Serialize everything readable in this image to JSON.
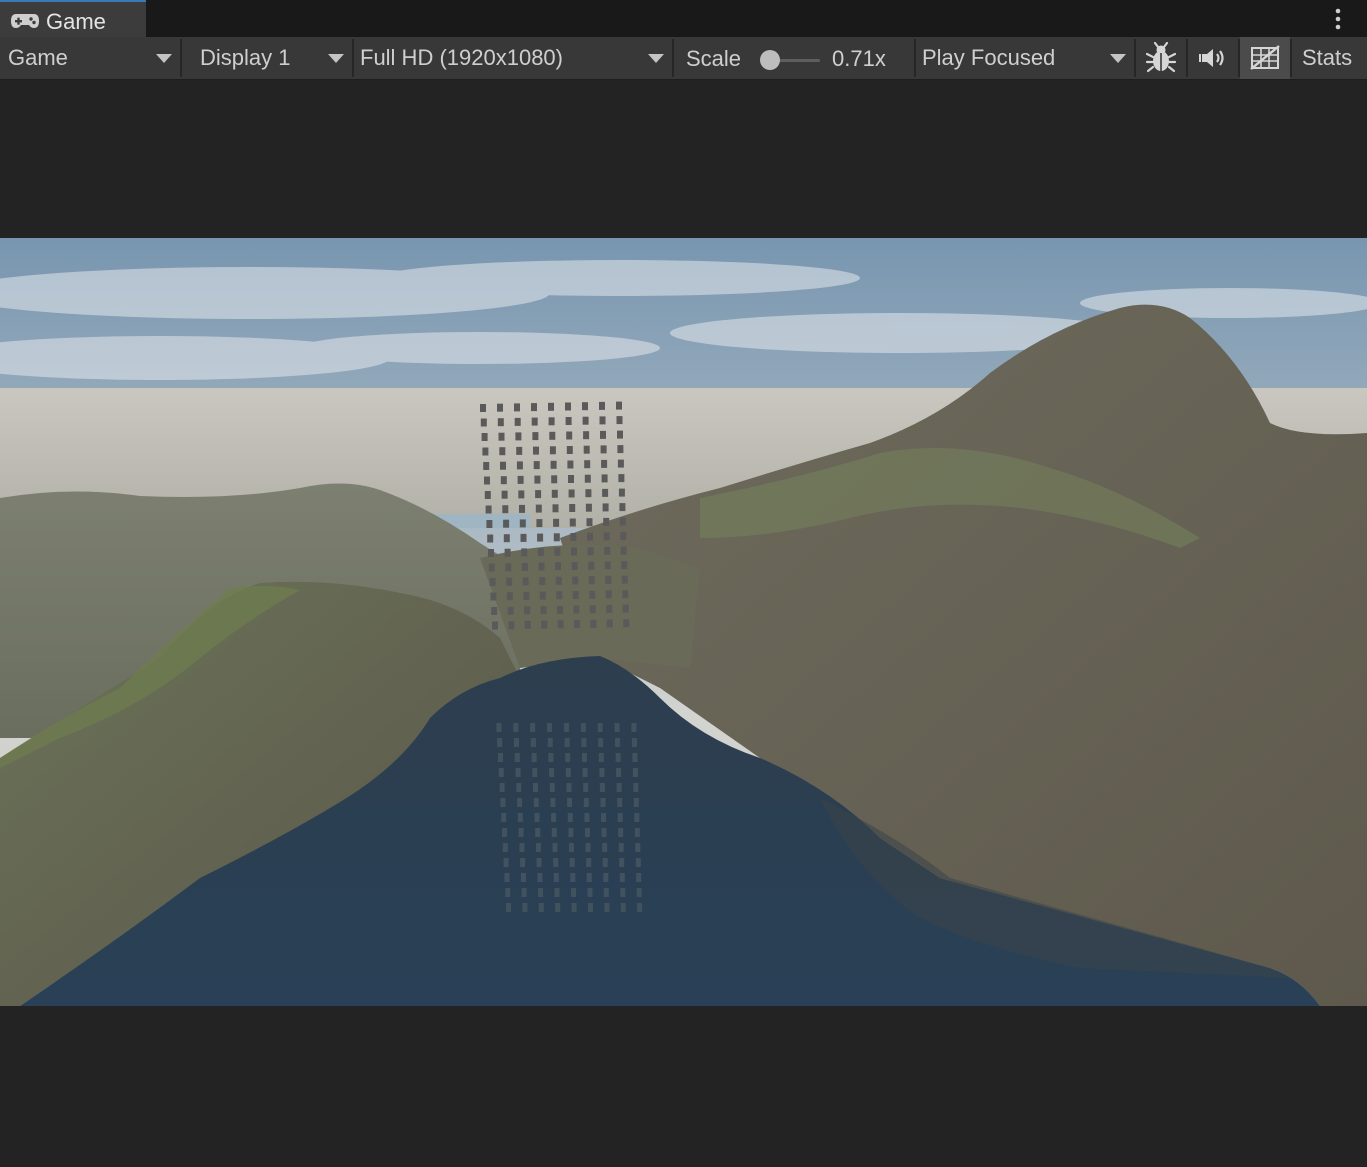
{
  "tab": {
    "label": "Game",
    "icon": "gamepad-icon"
  },
  "window_menu_icon": "kebab-menu-icon",
  "toolbar": {
    "view_dropdown": "Game",
    "display_dropdown": "Display 1",
    "resolution_dropdown": "Full HD (1920x1080)",
    "scale_label": "Scale",
    "scale_value": "0.71x",
    "scale_fraction": 0.0,
    "play_mode_dropdown": "Play Focused",
    "debug_icon": "bug-icon",
    "audio_icon": "speaker-icon",
    "gizmos_icon": "gizmos-grid-icon",
    "stats_label": "Stats"
  },
  "scene": {
    "description_icon": "game-render",
    "colors": {
      "sky_top": "#6f8fac",
      "sky_horizon": "#cfd3d4",
      "fog": "#b9bcbb",
      "mountain_rock": "#6a6555",
      "mountain_grass": "#6e7a55",
      "lake": "#2b3c4c",
      "cube": "#5a5a5a"
    }
  }
}
